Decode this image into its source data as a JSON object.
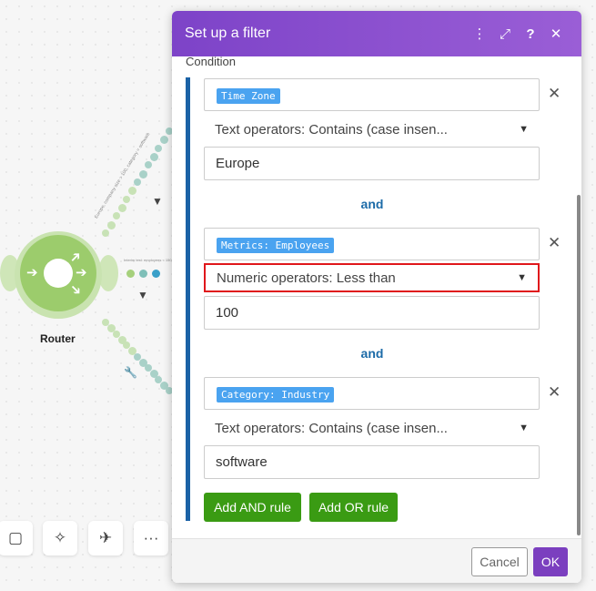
{
  "canvas": {
    "router_label": "Router",
    "route1_label": "Europe, company size > 100, category = software",
    "route2_label": "Interim test: employees < 150 after gp"
  },
  "toolbar": [
    {
      "icon": "note-icon",
      "glyph": "▢"
    },
    {
      "icon": "magic-wand-icon",
      "glyph": "✧"
    },
    {
      "icon": "airplane-icon",
      "glyph": "✈"
    },
    {
      "icon": "more-icon",
      "glyph": "···"
    }
  ],
  "dialog": {
    "title": "Set up a filter",
    "condition_label": "Condition",
    "rules": [
      {
        "field": "Time Zone",
        "operator": "Text operators: Contains (case insen...",
        "value": "Europe"
      },
      {
        "field": "Metrics: Employees",
        "operator": "Numeric operators: Less than",
        "value": "100"
      },
      {
        "field": "Category: Industry",
        "operator": "Text operators: Contains (case insen...",
        "value": "software"
      }
    ],
    "connector": "and",
    "add_and_label": "Add AND rule",
    "add_or_label": "Add OR rule",
    "cancel_label": "Cancel",
    "ok_label": "OK"
  },
  "colors": {
    "header": "#7d43c8",
    "accent_blue": "#1b62a6",
    "pill": "#4aa3f0",
    "green": "#3a9b13",
    "highlight": "#e0171b",
    "router": "#9ccc6c"
  }
}
